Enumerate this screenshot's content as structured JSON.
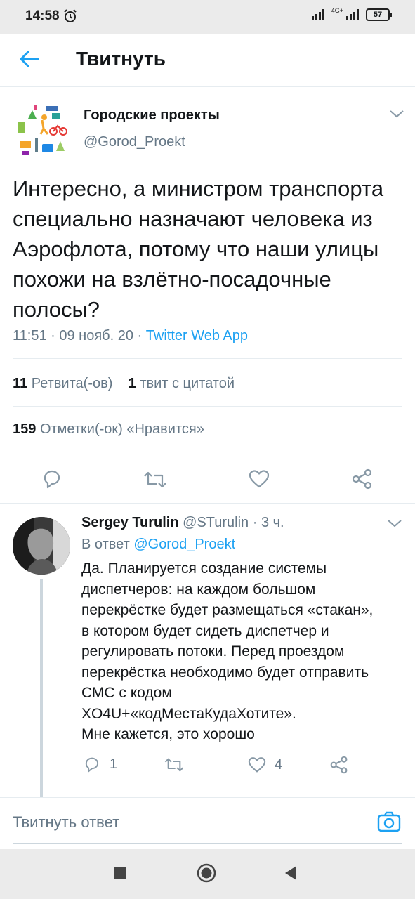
{
  "status_bar": {
    "time": "14:58",
    "network": "4G+",
    "battery": "57"
  },
  "header": {
    "title": "Твитнуть"
  },
  "tweet": {
    "author_name": "Городские проекты",
    "author_handle": "@Gorod_Proekt",
    "text": "Интересно, а министром транспорта специально назначают человека из Аэрофлота, потому что наши улицы похожи на взлётно-посадочные полосы?",
    "time": "11:51",
    "date": "09 нояб. 20",
    "source": "Twitter Web App",
    "retweets_count": "11",
    "retweets_label": "Ретвита(-ов)",
    "quotes_count": "1",
    "quotes_label": "твит с цитатой",
    "likes_count": "159",
    "likes_label": "Отметки(-ок) «Нравится»"
  },
  "reply": {
    "author_name": "Sergey Turulin",
    "author_handle": "@STurulin",
    "age": "3 ч.",
    "reply_to_label": "В ответ",
    "reply_to_handle": "@Gorod_Proekt",
    "text": "Да. Планируется создание системы\nдиспетчеров: на каждом большом\nперекрёстке будет размещаться «стакан»,\nв котором будет сидеть диспетчер и\nрегулировать потоки. Перед проездом\nперекрёстка необходимо будет отправить\nСМС с кодом\nXO4U+«кодМестаКудаХотите».\nМне кажется, это хорошо",
    "replies_count": "1",
    "likes_count": "4"
  },
  "compose": {
    "placeholder": "Твитнуть ответ"
  },
  "colors": {
    "accent": "#1da1f2",
    "secondary_text": "#657786",
    "icon_gray": "#8899a6"
  }
}
